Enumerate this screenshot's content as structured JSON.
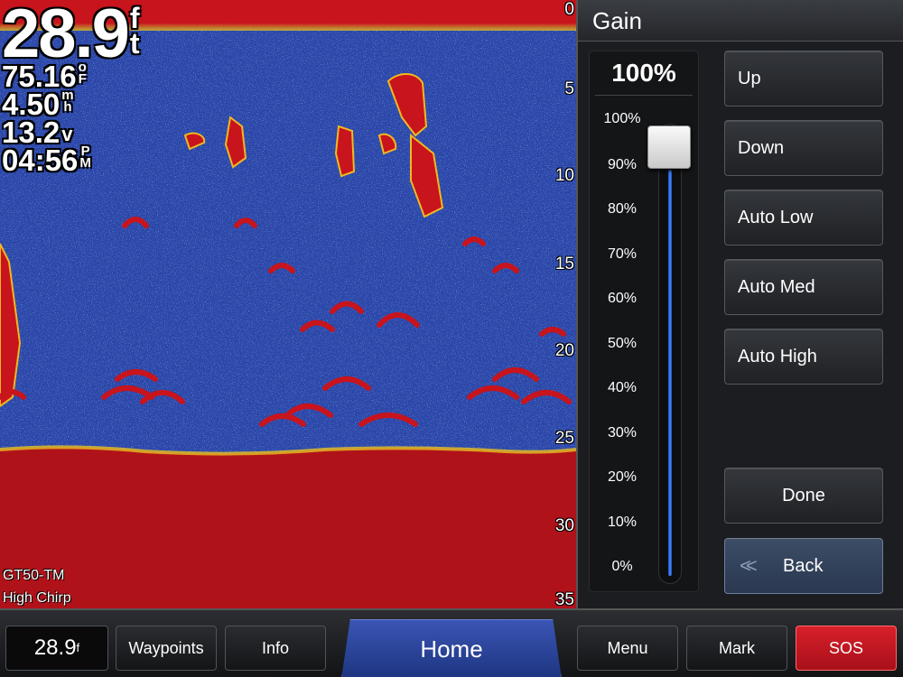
{
  "sonar": {
    "depth_value": "28.9",
    "depth_unit_top": "f",
    "depth_unit_bottom": "t",
    "temp_value": "75.16",
    "temp_unit_top": "o",
    "temp_unit_bottom": "F",
    "speed_value": "4.50",
    "speed_unit_top": "m",
    "speed_unit_bottom": "h",
    "voltage_value": "13.2",
    "voltage_unit": "v",
    "time_value": "04:56",
    "time_unit_top": "P",
    "time_unit_bottom": "M",
    "transducer": "GT50-TM",
    "frequency": "High Chirp",
    "depth_scale": [
      "0",
      "5",
      "10",
      "15",
      "20",
      "25",
      "30",
      "35"
    ],
    "colors": {
      "water": "#2b45a8",
      "bottom": "#b0121a",
      "return": "#c8141c"
    }
  },
  "gain_panel": {
    "title": "Gain",
    "current_value": "100%",
    "level_fraction": 1.0,
    "scale_labels": [
      "100%",
      "90%",
      "80%",
      "70%",
      "60%",
      "50%",
      "40%",
      "30%",
      "20%",
      "10%",
      "0%"
    ],
    "buttons": {
      "up": "Up",
      "down": "Down",
      "auto_low": "Auto Low",
      "auto_med": "Auto Med",
      "auto_high": "Auto High",
      "done": "Done",
      "back": "Back"
    },
    "back_icon": "double-chevron-left-icon"
  },
  "bottom_bar": {
    "depth": "28.9",
    "depth_unit": "f",
    "waypoints": "Waypoints",
    "info": "Info",
    "home": "Home",
    "menu": "Menu",
    "mark": "Mark",
    "sos": "SOS",
    "sos_color": "#d8202a"
  }
}
